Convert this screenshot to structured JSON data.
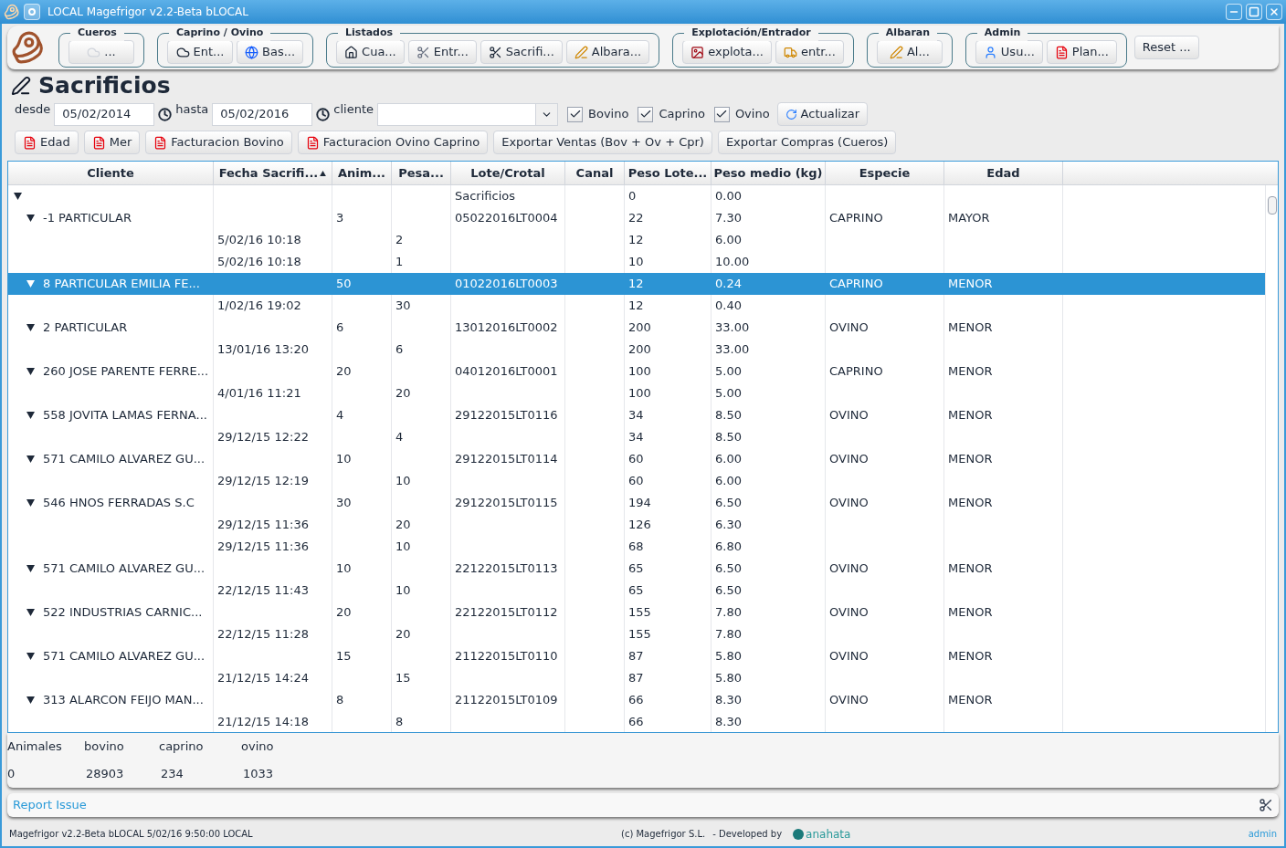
{
  "window": {
    "title": "LOCAL Magefrigor v2.2-Beta bLOCAL"
  },
  "toolbar": {
    "groups": [
      {
        "title": "Cueros",
        "buttons": [
          {
            "label": "..."
          }
        ]
      },
      {
        "title": "Caprino / Ovino",
        "buttons": [
          {
            "label": "Ent..."
          },
          {
            "label": "Bas..."
          }
        ]
      },
      {
        "title": "Listados",
        "buttons": [
          {
            "label": "Cua..."
          },
          {
            "label": "Entr..."
          },
          {
            "label": "Sacrifi..."
          },
          {
            "label": "Albara..."
          }
        ]
      },
      {
        "title": "Explotación/Entrador",
        "buttons": [
          {
            "label": "explota..."
          },
          {
            "label": "entr..."
          }
        ]
      },
      {
        "title": "Albaran",
        "buttons": [
          {
            "label": "Al..."
          }
        ]
      },
      {
        "title": "Admin",
        "buttons": [
          {
            "label": "Usu..."
          },
          {
            "label": "Plan..."
          }
        ]
      }
    ],
    "reset": "Reset ..."
  },
  "page": {
    "title": "Sacrificios"
  },
  "filters": {
    "desde_label": "desde",
    "desde": "05/02/2014",
    "hasta_label": "hasta",
    "hasta": "05/02/2016",
    "cliente_label": "cliente",
    "checks": [
      {
        "label": "Bovino",
        "checked": true
      },
      {
        "label": "Caprino",
        "checked": true
      },
      {
        "label": "Ovino",
        "checked": true
      }
    ],
    "refresh": "Actualizar"
  },
  "actions": [
    {
      "label": "Edad",
      "pdf": true
    },
    {
      "label": "Mer",
      "pdf": true
    },
    {
      "label": "Facturacion Bovino",
      "pdf": true
    },
    {
      "label": "Facturacion Ovino Caprino",
      "pdf": true
    },
    {
      "label": "Exportar Ventas (Bov + Ov + Cpr)",
      "pdf": false
    },
    {
      "label": "Exportar Compras (Cueros)",
      "pdf": false
    }
  ],
  "table": {
    "columns": [
      {
        "label": "Cliente"
      },
      {
        "label": "Fecha Sacrifi...",
        "sorted": true
      },
      {
        "label": "Anim..."
      },
      {
        "label": "Pesa..."
      },
      {
        "label": "Lote/Crotal"
      },
      {
        "label": "Canal"
      },
      {
        "label": "Peso Lote..."
      },
      {
        "label": "Peso medio (kg)"
      },
      {
        "label": "Especie"
      },
      {
        "label": "Edad"
      }
    ],
    "rows": [
      {
        "cells": [
          null,
          null,
          null,
          null,
          "Sacrificios",
          null,
          "0",
          "0.00",
          null,
          null
        ],
        "expanded": true,
        "selected": false,
        "children": [
          {
            "cells": [
              "-1 PARTICULAR",
              null,
              "3",
              null,
              "05022016LT0004",
              null,
              "22",
              "7.30",
              "CAPRINO",
              "MAYOR"
            ],
            "expanded": true,
            "selected": false,
            "children": [
              {
                "cells": [
                  null,
                  "5/02/16 10:18",
                  null,
                  "2",
                  null,
                  null,
                  "12",
                  "6.00",
                  null,
                  null
                ],
                "selected": false
              },
              {
                "cells": [
                  null,
                  "5/02/16 10:18",
                  null,
                  "1",
                  null,
                  null,
                  "10",
                  "10.00",
                  null,
                  null
                ],
                "selected": false
              }
            ]
          },
          {
            "cells": [
              "8 PARTICULAR EMILIA FE...",
              null,
              "50",
              null,
              "01022016LT0003",
              null,
              "12",
              "0.24",
              "CAPRINO",
              "MENOR"
            ],
            "expanded": true,
            "selected": true,
            "children": [
              {
                "cells": [
                  null,
                  "1/02/16 19:02",
                  null,
                  "30",
                  null,
                  null,
                  "12",
                  "0.40",
                  null,
                  null
                ],
                "selected": false
              }
            ]
          },
          {
            "cells": [
              "2 PARTICULAR",
              null,
              "6",
              null,
              "13012016LT0002",
              null,
              "200",
              "33.00",
              "OVINO",
              "MENOR"
            ],
            "expanded": true,
            "selected": false,
            "children": [
              {
                "cells": [
                  null,
                  "13/01/16 13:20",
                  null,
                  "6",
                  null,
                  null,
                  "200",
                  "33.00",
                  null,
                  null
                ],
                "selected": false
              }
            ]
          },
          {
            "cells": [
              "260 JOSE PARENTE FERRE...",
              null,
              "20",
              null,
              "04012016LT0001",
              null,
              "100",
              "5.00",
              "CAPRINO",
              "MENOR"
            ],
            "expanded": true,
            "selected": false,
            "children": [
              {
                "cells": [
                  null,
                  "4/01/16 11:21",
                  null,
                  "20",
                  null,
                  null,
                  "100",
                  "5.00",
                  null,
                  null
                ],
                "selected": false
              }
            ]
          },
          {
            "cells": [
              "558 JOVITA LAMAS FERNA...",
              null,
              "4",
              null,
              "29122015LT0116",
              null,
              "34",
              "8.50",
              "OVINO",
              "MENOR"
            ],
            "expanded": true,
            "selected": false,
            "children": [
              {
                "cells": [
                  null,
                  "29/12/15 12:22",
                  null,
                  "4",
                  null,
                  null,
                  "34",
                  "8.50",
                  null,
                  null
                ],
                "selected": false
              }
            ]
          },
          {
            "cells": [
              "571 CAMILO ALVAREZ GU...",
              null,
              "10",
              null,
              "29122015LT0114",
              null,
              "60",
              "6.00",
              "OVINO",
              "MENOR"
            ],
            "expanded": true,
            "selected": false,
            "children": [
              {
                "cells": [
                  null,
                  "29/12/15 12:19",
                  null,
                  "10",
                  null,
                  null,
                  "60",
                  "6.00",
                  null,
                  null
                ],
                "selected": false
              }
            ]
          },
          {
            "cells": [
              "546 HNOS FERRADAS S.C",
              null,
              "30",
              null,
              "29122015LT0115",
              null,
              "194",
              "6.50",
              "OVINO",
              "MENOR"
            ],
            "expanded": true,
            "selected": false,
            "children": [
              {
                "cells": [
                  null,
                  "29/12/15 11:36",
                  null,
                  "20",
                  null,
                  null,
                  "126",
                  "6.30",
                  null,
                  null
                ],
                "selected": false
              },
              {
                "cells": [
                  null,
                  "29/12/15 11:36",
                  null,
                  "10",
                  null,
                  null,
                  "68",
                  "6.80",
                  null,
                  null
                ],
                "selected": false
              }
            ]
          },
          {
            "cells": [
              "571 CAMILO ALVAREZ GU...",
              null,
              "10",
              null,
              "22122015LT0113",
              null,
              "65",
              "6.50",
              "OVINO",
              "MENOR"
            ],
            "expanded": true,
            "selected": false,
            "children": [
              {
                "cells": [
                  null,
                  "22/12/15 11:43",
                  null,
                  "10",
                  null,
                  null,
                  "65",
                  "6.50",
                  null,
                  null
                ],
                "selected": false
              }
            ]
          },
          {
            "cells": [
              "522 INDUSTRIAS CARNIC...",
              null,
              "20",
              null,
              "22122015LT0112",
              null,
              "155",
              "7.80",
              "OVINO",
              "MENOR"
            ],
            "expanded": true,
            "selected": false,
            "children": [
              {
                "cells": [
                  null,
                  "22/12/15 11:28",
                  null,
                  "20",
                  null,
                  null,
                  "155",
                  "7.80",
                  null,
                  null
                ],
                "selected": false
              }
            ]
          },
          {
            "cells": [
              "571 CAMILO ALVAREZ GU...",
              null,
              "15",
              null,
              "21122015LT0110",
              null,
              "87",
              "5.80",
              "OVINO",
              "MENOR"
            ],
            "expanded": true,
            "selected": false,
            "children": [
              {
                "cells": [
                  null,
                  "21/12/15 14:24",
                  null,
                  "15",
                  null,
                  null,
                  "87",
                  "5.80",
                  null,
                  null
                ],
                "selected": false
              }
            ]
          },
          {
            "cells": [
              "313 ALARCON FEIJO MAN...",
              null,
              "8",
              null,
              "21122015LT0109",
              null,
              "66",
              "8.30",
              "OVINO",
              "MENOR"
            ],
            "expanded": true,
            "selected": false,
            "children": [
              {
                "cells": [
                  null,
                  "21/12/15 14:18",
                  null,
                  "8",
                  null,
                  null,
                  "66",
                  "8.30",
                  null,
                  null
                ],
                "selected": false
              }
            ]
          }
        ]
      }
    ]
  },
  "summary": [
    {
      "label": "Animales",
      "value": "0"
    },
    {
      "label": "bovino",
      "value": "28903"
    },
    {
      "label": "caprino",
      "value": "234"
    },
    {
      "label": "ovino",
      "value": "1033"
    }
  ],
  "report_link": "Report Issue",
  "status_bar": {
    "left": "Magefrigor v2.2-Beta bLOCAL 5/02/16 9:50:00 LOCAL",
    "copyright": "(c)  Magefrigor S.L.",
    "developed": "- Developed by",
    "brand": "anahata",
    "user": "admin"
  }
}
